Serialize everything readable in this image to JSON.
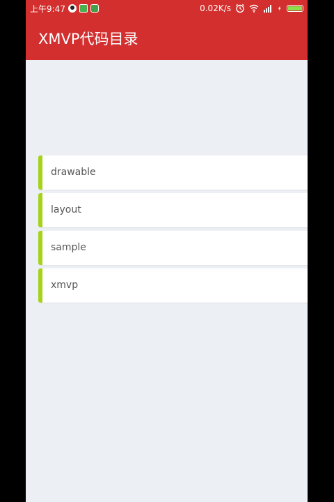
{
  "status_bar": {
    "time": "上午9:47",
    "net_speed": "0.02K/s",
    "icons_left": [
      "qq-icon",
      "reader-icon",
      "wechat-icon"
    ],
    "icons_right": [
      "alarm-icon",
      "wifi-icon",
      "signal-icon",
      "charging-icon",
      "battery-icon"
    ],
    "battery_level": 1.0,
    "battery_color": "#8BE14B"
  },
  "app_bar": {
    "title": "XMVP代码目录",
    "color": "#D32F2F"
  },
  "directory": {
    "accent_color": "#A6D31A",
    "items": [
      {
        "label": "drawable"
      },
      {
        "label": "layout"
      },
      {
        "label": "sample"
      },
      {
        "label": "xmvp"
      }
    ]
  }
}
